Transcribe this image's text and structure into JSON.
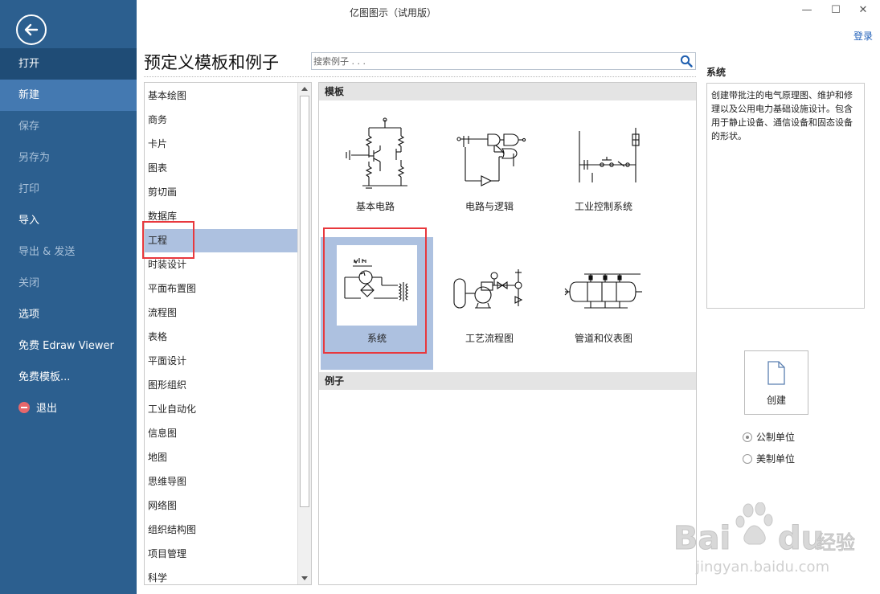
{
  "window": {
    "title": "亿图图示（试用版）",
    "minimize_glyph": "—",
    "maximize_glyph": "☐",
    "close_glyph": "✕",
    "login_label": "登录"
  },
  "sidebar": {
    "back_icon": "arrow-left-circle-icon",
    "items": [
      {
        "label": "打开",
        "state": "active"
      },
      {
        "label": "新建",
        "state": "selected"
      },
      {
        "label": "保存",
        "state": "disabled"
      },
      {
        "label": "另存为",
        "state": "disabled"
      },
      {
        "label": "打印",
        "state": "disabled"
      },
      {
        "label": "导入",
        "state": "normal"
      },
      {
        "label": "导出 & 发送",
        "state": "disabled"
      },
      {
        "label": "关闭",
        "state": "disabled"
      },
      {
        "label": "选项",
        "state": "normal"
      },
      {
        "label": "免费 Edraw Viewer",
        "state": "normal"
      },
      {
        "label": "免费模板...",
        "state": "normal"
      },
      {
        "label": "退出",
        "state": "normal",
        "icon": "exit-icon"
      }
    ],
    "colors": {
      "bg": "#2c5f8f",
      "active": "#1f4c76",
      "selected": "#4479b1"
    }
  },
  "main": {
    "heading": "预定义模板和例子",
    "search_placeholder": "搜索例子 . . .",
    "search_icon": "magnifier-icon"
  },
  "categories": {
    "selected": "工程",
    "items": [
      "基本绘图",
      "商务",
      "卡片",
      "图表",
      "剪切画",
      "数据库",
      "工程",
      "时装设计",
      "平面布置图",
      "流程图",
      "表格",
      "平面设计",
      "图形组织",
      "工业自动化",
      "信息图",
      "地图",
      "思维导图",
      "网络图",
      "组织结构图",
      "项目管理",
      "科学"
    ]
  },
  "templates": {
    "section_label": "模板",
    "items": [
      {
        "label": "基本电路",
        "icon": "basic-circuit-thumbnail"
      },
      {
        "label": "电路与逻辑",
        "icon": "circuit-logic-thumbnail"
      },
      {
        "label": "工业控制系统",
        "icon": "industrial-control-thumbnail"
      },
      {
        "label": "系统",
        "icon": "system-thumbnail",
        "selected": true
      },
      {
        "label": "工艺流程图",
        "icon": "process-flow-thumbnail"
      },
      {
        "label": "管道和仪表图",
        "icon": "piping-instrument-thumbnail"
      }
    ]
  },
  "examples": {
    "section_label": "例子"
  },
  "details": {
    "title": "系统",
    "description": "创建带批注的电气原理图、维护和修理以及公用电力基础设施设计。包含用于静止设备、通信设备和固态设备的形状。",
    "create_label": "创建",
    "create_icon": "new-document-icon",
    "units": [
      {
        "label": "公制单位",
        "checked": true
      },
      {
        "label": "美制单位",
        "checked": false
      }
    ]
  },
  "highlight_color": "#e8383d",
  "watermark": {
    "brand": "Bai",
    "brand_tail": "du",
    "service": "经验",
    "url": "jingyan.baidu.com"
  }
}
